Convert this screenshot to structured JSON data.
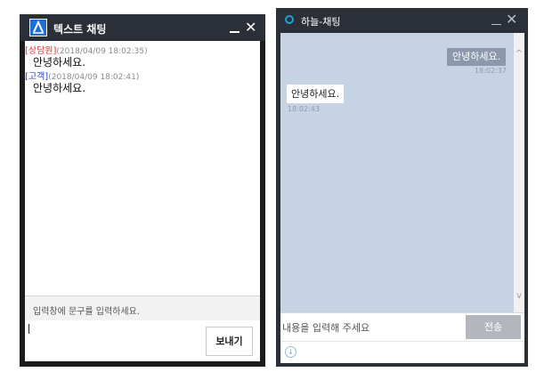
{
  "left_window": {
    "title": "텍스트 채팅",
    "close_glyph": "✕",
    "messages": [
      {
        "sender": "[상담원]",
        "time": "(2018/04/09 18:02:35)",
        "text": "안녕하세요."
      },
      {
        "sender": "[고객]",
        "time": "(2018/04/09 18:02:41)",
        "text": "안녕하세요."
      }
    ],
    "input_placeholder": "입력창에 문구를 입력하세요.",
    "send_label": "보내기"
  },
  "right_window": {
    "title": "하늘-채팅",
    "close_glyph": "✕",
    "messages": [
      {
        "direction": "outgoing",
        "text": "안녕하세요.",
        "time": "18:02:37"
      },
      {
        "direction": "incoming",
        "text": "안녕하세요.",
        "time": "18:02:43"
      }
    ],
    "input_placeholder": "내용을 입력해 주세요",
    "send_label": "전송",
    "scroll_up_glyph": "^",
    "scroll_down_glyph": "v"
  },
  "colors": {
    "agent_name": "#e03232",
    "customer_name": "#2a3fb8",
    "right_chat_bg": "#c5d3e5",
    "outgoing_bubble": "#8c99ab"
  }
}
